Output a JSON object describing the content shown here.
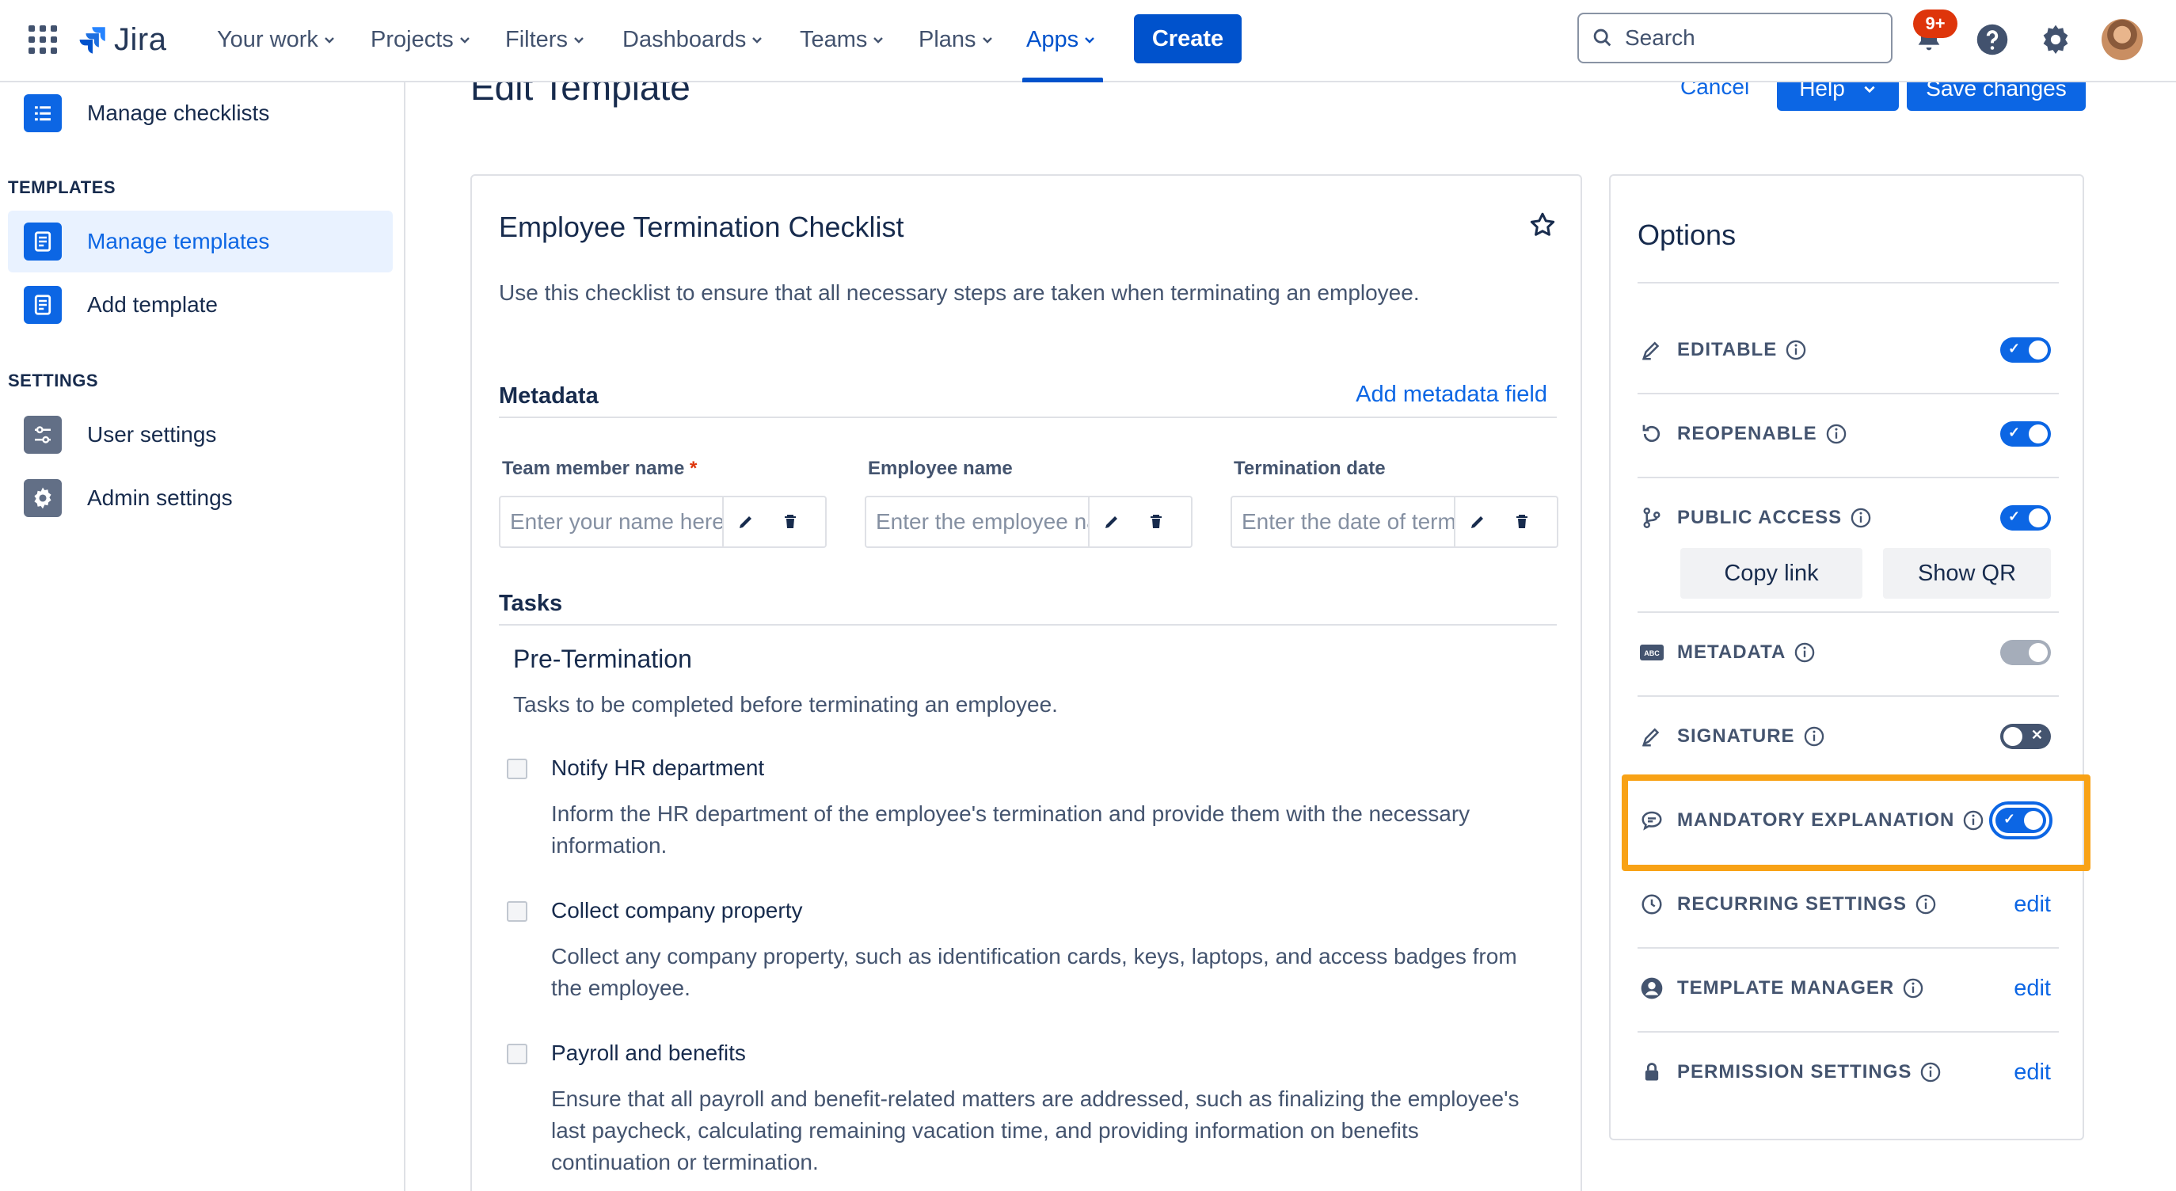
{
  "nav": {
    "app_name": "Jira",
    "items": [
      {
        "label": "Your work"
      },
      {
        "label": "Projects"
      },
      {
        "label": "Filters"
      },
      {
        "label": "Dashboards"
      },
      {
        "label": "Teams"
      },
      {
        "label": "Plans"
      },
      {
        "label": "Apps"
      }
    ],
    "create_label": "Create",
    "search_placeholder": "Search",
    "notification_badge": "9+",
    "accent_color": "#0052CC"
  },
  "sidebar": {
    "items": [
      {
        "label": "Manage checklists",
        "icon": "list-icon"
      },
      {
        "label": "Manage templates",
        "icon": "template-icon"
      },
      {
        "label": "Add template",
        "icon": "template-icon"
      },
      {
        "label": "User settings",
        "icon": "sliders-icon"
      },
      {
        "label": "Admin settings",
        "icon": "gear-icon"
      }
    ],
    "sections": {
      "templates": "TEMPLATES",
      "settings": "SETTINGS"
    }
  },
  "header": {
    "title": "Edit Template",
    "cancel_label": "Cancel",
    "help_label": "Help",
    "save_label": "Save changes"
  },
  "template": {
    "title": "Employee Termination Checklist",
    "description": "Use this checklist to ensure that all necessary steps are taken when terminating an employee.",
    "metadata_heading": "Metadata",
    "add_metadata_label": "Add metadata field",
    "fields": [
      {
        "label": "Team member name",
        "required_mark": "*",
        "placeholder": "Enter your name here"
      },
      {
        "label": "Employee name",
        "placeholder": "Enter the employee name"
      },
      {
        "label": "Termination date",
        "placeholder": "Enter the date of termination"
      }
    ],
    "tasks_heading": "Tasks",
    "group": {
      "title": "Pre-Termination",
      "description": "Tasks to be completed before terminating an employee."
    },
    "tasks": [
      {
        "title": "Notify HR department",
        "description": "Inform the HR department of the employee's termination and provide them with the necessary information."
      },
      {
        "title": "Collect company property",
        "description": "Collect any company property, such as identification cards, keys, laptops, and access badges from the employee."
      },
      {
        "title": "Payroll and benefits",
        "description": "Ensure that all payroll and benefit-related matters are addressed, such as finalizing the employee's last paycheck, calculating remaining vacation time, and providing information on benefits continuation or termination."
      }
    ]
  },
  "options": {
    "title": "Options",
    "copy_link_label": "Copy link",
    "show_qr_label": "Show QR",
    "edit_label": "edit",
    "rows": [
      {
        "label": "EDITABLE",
        "state": "on"
      },
      {
        "label": "REOPENABLE",
        "state": "on"
      },
      {
        "label": "PUBLIC ACCESS",
        "state": "on"
      },
      {
        "label": "METADATA",
        "state": "disabled"
      },
      {
        "label": "SIGNATURE",
        "state": "off"
      },
      {
        "label": "MANDATORY EXPLANATION",
        "state": "on"
      },
      {
        "label": "RECURRING SETTINGS",
        "state": "edit"
      },
      {
        "label": "TEMPLATE MANAGER",
        "state": "edit"
      },
      {
        "label": "PERMISSION SETTINGS",
        "state": "edit"
      }
    ],
    "highlight_color": "#F8A216"
  }
}
